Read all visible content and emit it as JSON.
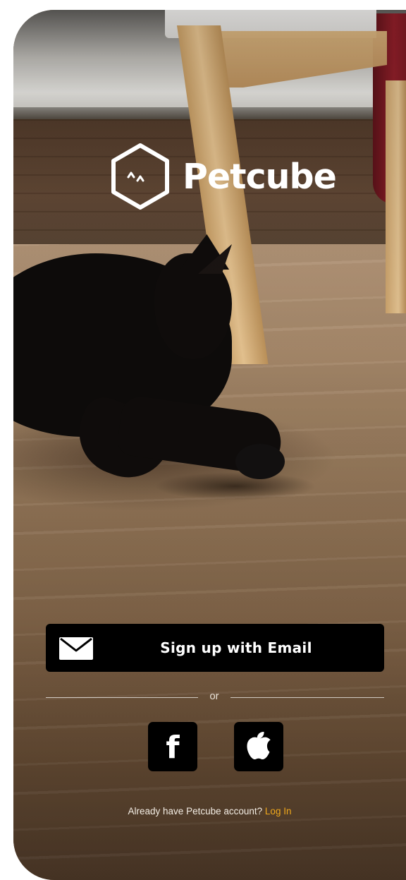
{
  "brand": {
    "name": "Petcube"
  },
  "cta": {
    "email_label": "Sign up with Email",
    "divider_text": "or"
  },
  "social": {
    "facebook_glyph": "f",
    "facebook_icon": "facebook-icon",
    "apple_icon": "apple-icon"
  },
  "login": {
    "prompt": "Already have Petcube account?",
    "link_label": "Log In"
  },
  "colors": {
    "accent": "#f0a81c",
    "button_bg": "#000000",
    "text_light": "#ffffff"
  }
}
